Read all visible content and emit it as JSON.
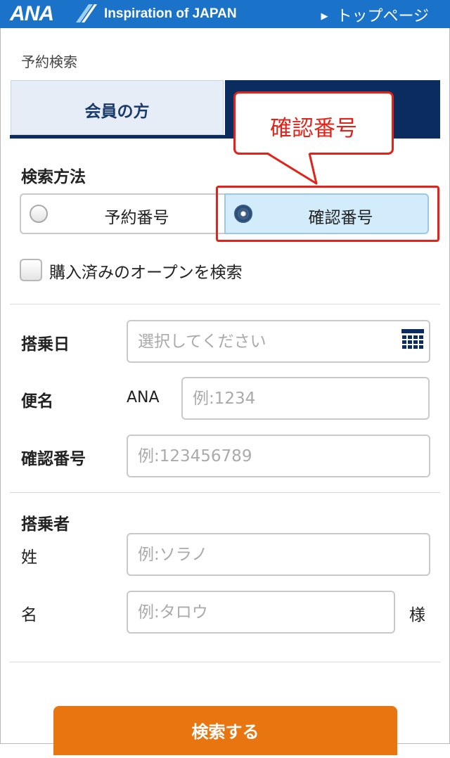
{
  "header": {
    "logo": "ANA",
    "tagline": "Inspiration of JAPAN",
    "top_link": "トップページ",
    "brand_color": "#1b73c9"
  },
  "page_title": "予約検索",
  "tabs": [
    {
      "label": "会員の方",
      "selected": true
    },
    {
      "label": "",
      "selected": false
    }
  ],
  "callout": {
    "text": "確認番号",
    "color": "#e2231a"
  },
  "search_method": {
    "label": "検索方法",
    "options": [
      {
        "label": "予約番号",
        "selected": false
      },
      {
        "label": "確認番号",
        "selected": true
      }
    ]
  },
  "open_ticket_checkbox": {
    "label": "購入済みのオープンを検索",
    "checked": false
  },
  "fields": {
    "boarding_date": {
      "label": "搭乗日",
      "placeholder": "選択してください",
      "icon": "calendar-icon"
    },
    "flight_number": {
      "label": "便名",
      "prefix": "ANA",
      "placeholder": "例:1234"
    },
    "confirmation_number": {
      "label": "確認番号",
      "placeholder": "例:123456789"
    }
  },
  "passenger": {
    "label": "搭乗者",
    "last_name": {
      "label": "姓",
      "placeholder": "例:ソラノ"
    },
    "first_name": {
      "label": "名",
      "placeholder": "例:タロウ",
      "suffix": "様"
    }
  },
  "submit": {
    "label": "検索する",
    "color": "#e8750f"
  }
}
